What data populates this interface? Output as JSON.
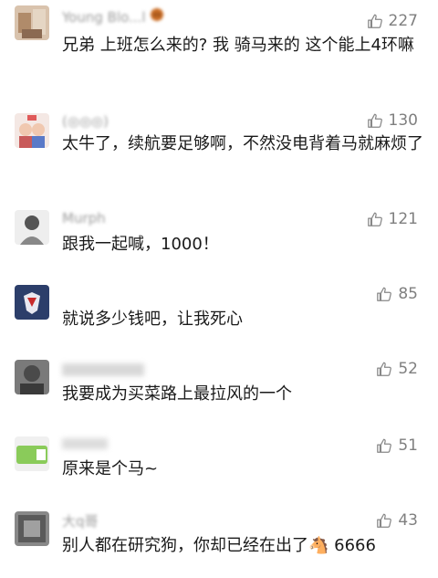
{
  "comments": [
    {
      "username": "Young Blo...l",
      "text": "兄弟 上班怎么来的? 我 骑马来的 这个能上4环嘛",
      "likes": "227",
      "avatar_color": "#c8a88a"
    },
    {
      "username": "(◎◎◎)",
      "text": "太牛了，续航要足够啊，不然没电背着马就麻烦了",
      "likes": "130",
      "avatar_color": "#e8d4d0"
    },
    {
      "username": "Murph",
      "text": "跟我一起喊，1000！",
      "likes": "121",
      "avatar_color": "#d8d8d8"
    },
    {
      "username": "",
      "text": "就说多少钱吧，让我死心",
      "likes": "85",
      "avatar_color": "#3a5a9a"
    },
    {
      "username": "",
      "text": "我要成为买菜路上最拉风的一个",
      "likes": "52",
      "avatar_color": "#5a5a5a"
    },
    {
      "username": "",
      "text": "原来是个马~",
      "likes": "51",
      "avatar_color": "#8acb5a"
    },
    {
      "username": "大q哥",
      "text": "别人都在研究狗，你却已经在出了🐴 6666",
      "likes": "43",
      "avatar_color": "#6a6a6a"
    }
  ]
}
